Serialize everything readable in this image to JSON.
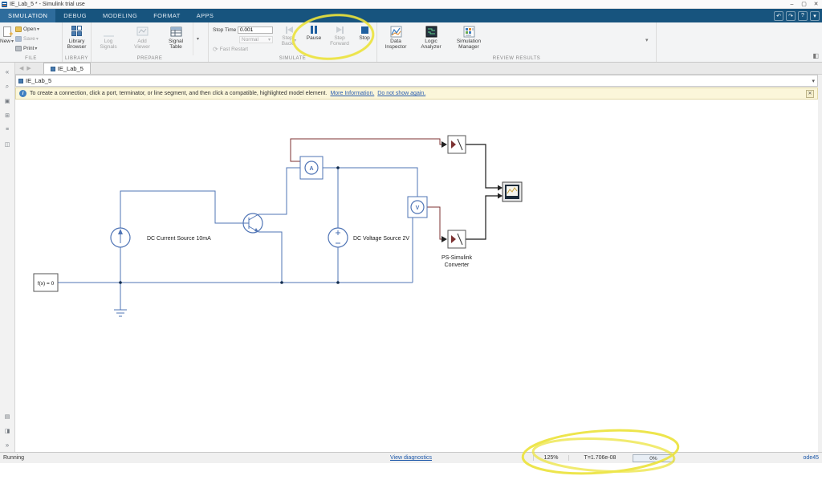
{
  "window": {
    "title": "IE_Lab_5 * - Simulink trial use"
  },
  "icons": {
    "minimize": "–",
    "maximize": "▢",
    "close": "✕",
    "undo": "↶",
    "redo": "↷",
    "help": "?",
    "caret_down": "▾",
    "back": "◀",
    "forward": "▶",
    "sidebar_collapse": "«",
    "sidebar_expand": "»",
    "zoom": "⌕",
    "annotation_tool": "▣",
    "grid_tool": "⊞",
    "list_tool": "≡",
    "panel_tool": "◫",
    "viewmark_tool": "▤",
    "split_tool": "◨",
    "fast_restart": "⟳",
    "info": "i",
    "property_panel": "◧"
  },
  "ribbon_tabs": [
    "SIMULATION",
    "DEBUG",
    "MODELING",
    "FORMAT",
    "APPS"
  ],
  "file": {
    "caption": "FILE",
    "new": "New",
    "open": "Open",
    "save": "Save",
    "print": "Print"
  },
  "library": {
    "caption": "LIBRARY",
    "browser": "Library\nBrowser"
  },
  "prepare": {
    "caption": "PREPARE",
    "log_signals": "Log\nSignals",
    "add_viewer": "Add\nViewer",
    "signal_table": "Signal\nTable"
  },
  "simulate": {
    "caption": "SIMULATE",
    "stop_time_label": "Stop Time",
    "stop_time_value": "0.001",
    "mode": "Normal",
    "fast_restart": "Fast Restart",
    "step_back": "Step\nBack",
    "pause": "Pause",
    "step_forward": "Step\nForward",
    "stop": "Stop"
  },
  "review": {
    "caption": "REVIEW RESULTS",
    "data_inspector": "Data\nInspector",
    "logic_analyzer": "Logic\nAnalyzer",
    "simulation_manager": "Simulation\nManager"
  },
  "doc_tab": {
    "label": "IE_Lab_5"
  },
  "address": {
    "value": "IE_Lab_5"
  },
  "notification": {
    "message": "To create a connection, click a port, terminator, or line segment, and then click a compatible, highlighted model element.",
    "more_info": "More Information.",
    "dismiss": "Do not show again."
  },
  "diagram": {
    "solver_block": "f(x) = 0",
    "current_source_label": "DC Current Source 10mA",
    "voltage_source_label": "DC Voltage Source 2V",
    "ammeter_letter": "A",
    "voltmeter_letter": "V",
    "converter_label_line1": "PS-Simulink",
    "converter_label_line2": "Converter"
  },
  "status": {
    "state": "Running",
    "diagnostics_link": "View diagnostics",
    "zoom": "125%",
    "sim_time": "T=1.706e-08",
    "progress": "0%",
    "solver": "ode45"
  }
}
